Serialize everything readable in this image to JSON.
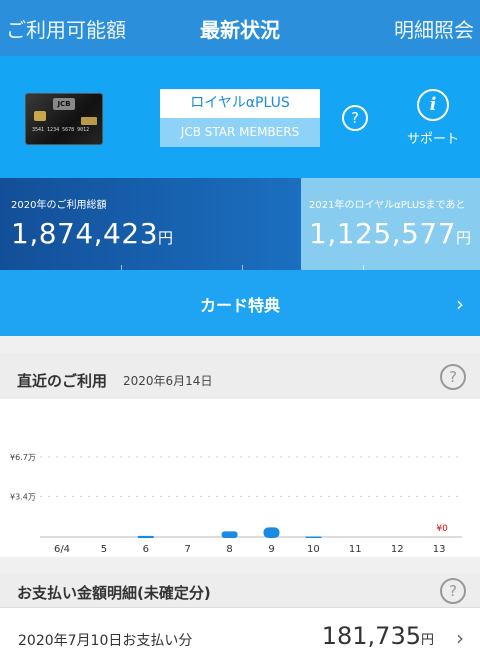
{
  "tabs": {
    "left": "ご利用可能額",
    "center": "最新状況",
    "right": "明細照会"
  },
  "card": {
    "brand": "JCB",
    "number": "3541 1234 5678 9012",
    "name_primary": "ロイヤルαPLUS",
    "name_secondary": "JCB STAR MEMBERS",
    "help": "?",
    "support_icon": "i",
    "support_label": "サポート"
  },
  "totals": {
    "usage_label": "2020年のご利用総額",
    "usage_amount": "1,874,423",
    "remaining_label": "2021年のロイヤルαPLUSまであと",
    "remaining_amount": "1,125,577",
    "currency": "円"
  },
  "benefits": {
    "label": "カード特典",
    "arrow": "›"
  },
  "recent": {
    "title": "直近のご利用",
    "date": "2020年6月14日",
    "help": "?"
  },
  "chart_data": {
    "type": "bar",
    "categories": [
      "6/4",
      "5",
      "6",
      "7",
      "8",
      "9",
      "10",
      "11",
      "12",
      "13"
    ],
    "values": [
      0,
      0,
      900,
      0,
      4700,
      8100,
      400,
      0,
      0,
      0
    ],
    "y_ticks": [
      {
        "label": "¥6.7万",
        "value": 67000
      },
      {
        "label": "¥3.4万",
        "value": 34000
      }
    ],
    "ylim": [
      0,
      67000
    ],
    "zero_label": "¥0",
    "bar_color": "#1a8be0",
    "zero_color": "#e00000"
  },
  "payment": {
    "title": "お支払い金額明細(未確定分)",
    "help": "?",
    "date_label": "2020年7月10日お支払い分",
    "amount": "181,735",
    "currency": "円",
    "arrow": "›"
  },
  "colors": {
    "tab_bg": "#2b8fdc",
    "panel_bg": "#14a5f5",
    "accent": "#1a8be0"
  }
}
